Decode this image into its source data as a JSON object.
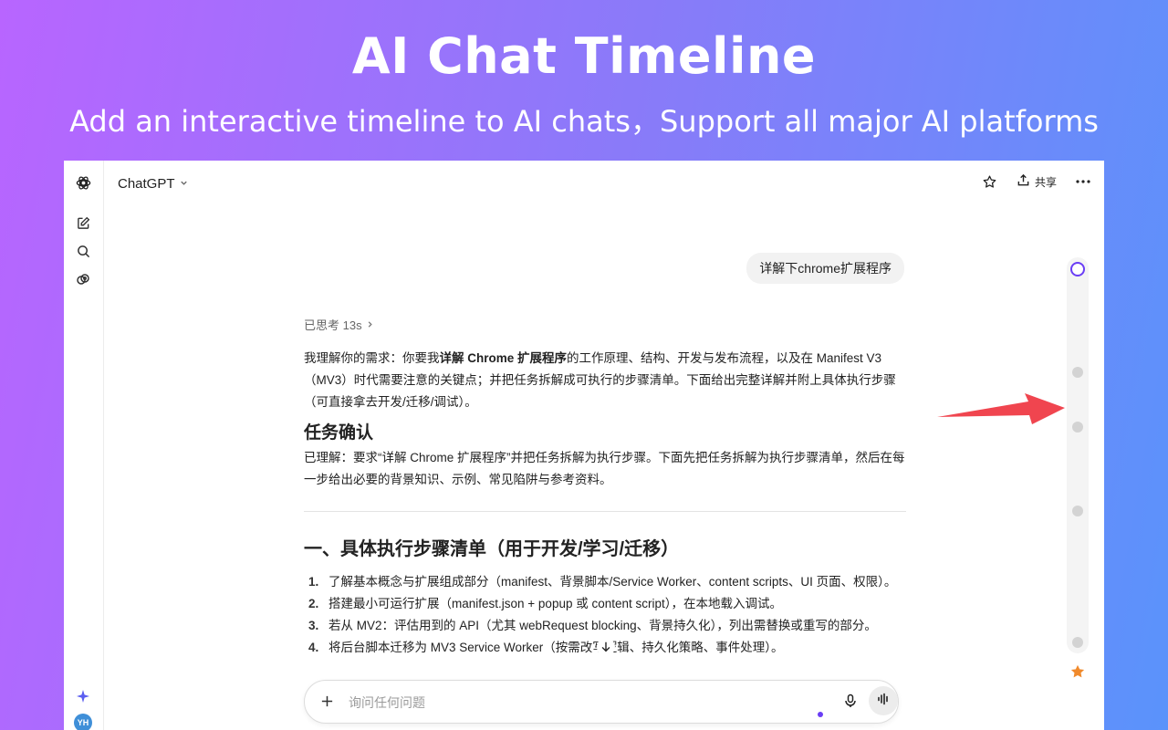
{
  "hero": {
    "title": "AI Chat Timeline",
    "subtitle": "Add an interactive timeline to AI chats，Support all major AI platforms"
  },
  "sidebar": {
    "icons": [
      "chatgpt-logo-icon",
      "new-chat-icon",
      "search-icon",
      "library-icon",
      "sparkle-icon"
    ],
    "avatar_initials": "YH"
  },
  "topbar": {
    "model_name": "ChatGPT",
    "share_label": "共享"
  },
  "conversation": {
    "user_message": "详解下chrome扩展程序",
    "thought_label": "已思考 13s",
    "intro_a": "我理解你的需求：你要我",
    "intro_bold": "详解 Chrome 扩展程序",
    "intro_b": "的工作原理、结构、开发与发布流程，以及在 Manifest V3（MV3）时代需要注意的关键点；并把任务拆解成可执行的步骤清单。下面给出完整详解并附上具体执行步骤（可直接拿去开发/迁移/调试）。",
    "confirm_heading": "任务确认",
    "confirm_text": "已理解：要求“详解 Chrome 扩展程序”并把任务拆解为执行步骤。下面先把任务拆解为执行步骤清单，然后在每一步给出必要的背景知识、示例、常见陷阱与参考资料。",
    "steps_heading": "一、具体执行步骤清单（用于开发/学习/迁移）",
    "steps": [
      {
        "num": "1.",
        "text": "了解基本概念与扩展组成部分（manifest、背景脚本/Service Worker、content scripts、UI 页面、权限）。"
      },
      {
        "num": "2.",
        "text": "搭建最小可运行扩展（manifest.json + popup 或 content script），在本地载入调试。"
      },
      {
        "num": "3.",
        "text": "若从 MV2：评估用到的 API（尤其 webRequest blocking、背景持久化），列出需替换或重写的部分。"
      },
      {
        "num": "4.",
        "text": "将后台脚本迁移为 MV3 Service Worker（按需改写逻辑、持久化策略、事件处理）。"
      }
    ]
  },
  "composer": {
    "placeholder": "询问任何问题"
  },
  "timeline": {
    "node_count": 6,
    "active_index": 0,
    "star_color": "#f08a2c",
    "accent_color": "#6a3df5"
  },
  "colors": {
    "arrow": "#f0454f",
    "avatar": "#3f8fd8"
  }
}
